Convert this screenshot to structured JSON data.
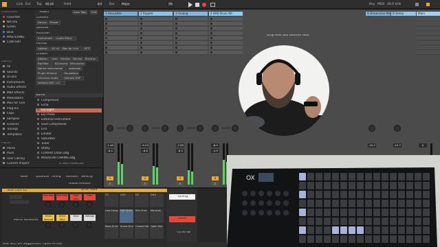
{
  "topbar": {
    "items": [
      "Link",
      "Ext",
      "Tap",
      "80.00",
      "Hold",
      "4/4",
      "Bar",
      "Major"
    ],
    "position": "98",
    "key_label": "Key",
    "midi_label": "MIDI",
    "cpu": "48.0 kHz"
  },
  "browser": {
    "collections_head": "Collections",
    "collections": [
      {
        "label": "Favorites",
        "color": "#e5473b"
      },
      {
        "label": "NATIVE",
        "color": "#f2a33a"
      },
      {
        "label": "Green",
        "color": "#7cc85a"
      },
      {
        "label": "Blue",
        "color": "#4d8fe6"
      },
      {
        "label": "MASTERING",
        "color": "#8b6be3"
      },
      {
        "label": "CONTENT",
        "color": "#aaaaaa"
      }
    ],
    "library_head": "Library",
    "library": [
      "All",
      "Sounds",
      "Drums",
      "Instruments",
      "Audio Effects",
      "MIDI Effects",
      "Modulators",
      "Max for Live",
      "Plug-Ins",
      "Clips",
      "Samples",
      "Grooves",
      "Tunings",
      "Templates"
    ],
    "places_head": "Places",
    "places": [
      "Packs",
      "Push",
      "User Library",
      "Current Project"
    ],
    "filters": {
      "title": "Filters",
      "auto_tags": "Auto Tags",
      "search": "Edit",
      "content_label": "Content",
      "content_chips": [
        "Device",
        "Preset"
      ],
      "devices_label": "Devices",
      "function_label": "Function",
      "function_chips": [
        "Instrument",
        "Audio Effect"
      ],
      "format_label": "Format",
      "format_chips": [
        "Ableton",
        "AU v2",
        "Max for Live",
        "VST3"
      ],
      "creator_label": "Creator",
      "creator_chips": [
        "Ableton",
        "User",
        "Denton",
        "Denise",
        "Electron",
        "FabFilter",
        "KScreams",
        "Mitronome",
        "Native Instruments",
        "sakaudio",
        "Plugin Alliance",
        "Soundtoys",
        "Universal Audio",
        "Valhalla DSP",
        "Valhalla DSP, LLC"
      ]
    },
    "names_head": "Name",
    "names": [
      "Compressor",
      "Echo",
      "EQ Eight",
      "EQ Three",
      "External Instrument",
      "Glue Compressor",
      "LFO",
      "Limiter",
      "Saturator",
      "Tuner",
      "Utility",
      "Content Chain.adg",
      "MODULAR CHAINS.adg"
    ],
    "selected_name": "EQ Eight",
    "status": "2 item selected"
  },
  "session": {
    "tracks": [
      {
        "name": "1 Abscatter",
        "color": "#6fb0e3"
      },
      {
        "name": "2 Rippler",
        "color": "#7fc7f2"
      },
      {
        "name": "3 Analog",
        "color": "#7cb9ea"
      },
      {
        "name": "4 808 Drum Kit",
        "color": "#80cfff"
      }
    ],
    "returns": [
      {
        "name": "A Dimension Ma",
        "color": "#7ab7e0"
      },
      {
        "name": "B Delay",
        "color": "#8ac6ee"
      }
    ],
    "main": {
      "name": "Main",
      "color": "#9ed1f3"
    },
    "drop_hint": "Drop Files and Devices Here",
    "sends_label": "Sends",
    "volumes": [
      "-1.40",
      "-9.23",
      "-3.58",
      "-6.0"
    ],
    "volumes_b": [
      "-6.4",
      "-6.6",
      "-6.4",
      "-4.5"
    ],
    "return_volumes": [
      "-20.2",
      "-10.7",
      "0"
    ],
    "track_numbers": [
      "1",
      "2",
      "3",
      "4"
    ],
    "solo_label": "S"
  },
  "devices": {
    "groove_pool": "Groove Pool",
    "browser_tabs": [
      "Base",
      "Quantize",
      "Timing",
      "Random",
      "Velocity"
    ],
    "global_amount": "Global Amount",
    "instrument": "808 Core Kit",
    "rack_name": "Drum Rack",
    "macro_label": "Macro Variations",
    "macros": [
      {
        "label": "Low Amp",
        "color": "#e5473b"
      },
      {
        "label": "Mid Gain",
        "color": "#e5473b"
      },
      {
        "label": "High Gain",
        "color": "#e5473b"
      },
      {
        "label": "Gain",
        "color": "#e5473b"
      },
      {
        "label": "Drive Amount",
        "color": "#f2c54a"
      },
      {
        "label": "Drive Tone",
        "color": "#f2c54a"
      },
      {
        "label": "Glue",
        "color": "#dcdcdc"
      },
      {
        "label": "Voltage",
        "color": "#dcdcdc"
      }
    ],
    "pads": [
      "C2",
      "C#2",
      "D2",
      "D#2",
      "Low Conga",
      "Hat Open",
      "Rim Shot",
      "Maracas",
      "Bass Drum",
      "Snare Drum",
      "Closed Hat",
      "Open Hat"
    ],
    "tuning_label": "Tuning",
    "level_label": "Level",
    "value": "-14.00 dB",
    "status": "808 (Kit) Sill Suggestion: Open Hi Hat"
  },
  "photo": {
    "brand": "OX"
  }
}
